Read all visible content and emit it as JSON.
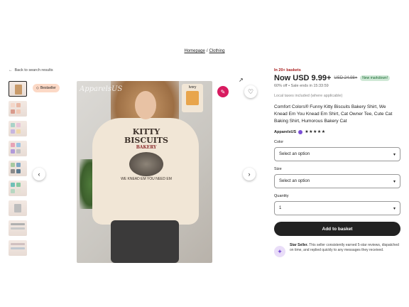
{
  "breadcrumb": {
    "home": "Homepage",
    "sep": "/",
    "category": "Clothing"
  },
  "back_link": {
    "icon": "arrow-left-icon",
    "label": "Back to search results"
  },
  "bestseller": {
    "icon": "award-icon",
    "label": "Bestseller"
  },
  "image": {
    "design_title": "KITTY BISCUITS",
    "design_subtitle": "BAKERY",
    "design_tagline": "WE KNEAD EM YOU NEED EM",
    "watermark": "ApparelsUS",
    "color_tag": "Ivory"
  },
  "listing": {
    "in_baskets": "In 20+ baskets",
    "price_now": "Now USD 9.99+",
    "price_old": "USD 24.98+",
    "price_badge": "New markdown!",
    "sale_text": "60% off • Sale ends in 15:33:59",
    "taxes": "Local taxes included (where applicable)",
    "title": "Comfort Colors® Funny Kitty Biscuits Bakery Shirt, We Knead Em You Knead Em Shirt, Cat Owner Tee, Cute Cat Baking Shirt, Humorous Bakery Cat",
    "seller": "ApparelsUS",
    "stars": "★★★★★",
    "rating": 5
  },
  "form": {
    "color_label": "Color",
    "color_value": "Select an option",
    "size_label": "Size",
    "size_value": "Select an option",
    "quantity_label": "Quantity",
    "quantity_value": "1",
    "add_button": "Add to basket"
  },
  "star_seller": {
    "title": "Star Seller.",
    "text": " This seller consistently earned 5-star reviews, dispatched on time, and replied quickly to any messages they received."
  },
  "icons": {
    "prev": "‹",
    "next": "›",
    "heart": "♡",
    "edit": "✎",
    "caret": "▾",
    "star_seller_icon": "✦"
  },
  "colors": {
    "accent_red": "#d81b60",
    "sale_green": "#1a6b33",
    "badge_green_bg": "#cfe8d6",
    "button_dark": "#222222"
  }
}
